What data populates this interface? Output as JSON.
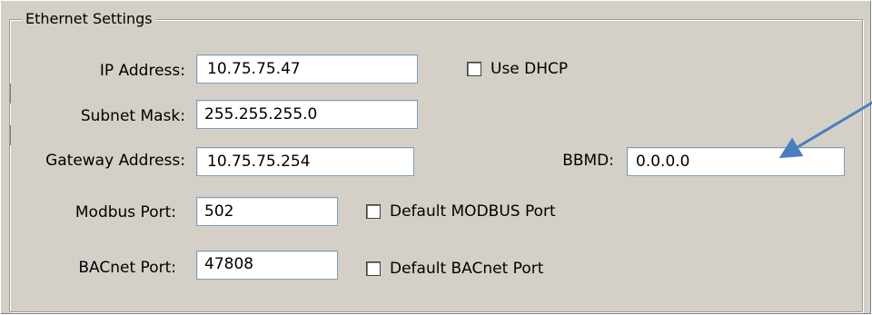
{
  "group": {
    "title": "Ethernet Settings"
  },
  "fields": {
    "ip_address": {
      "label": "IP Address:",
      "value": "10.75.75.47"
    },
    "subnet_mask": {
      "label": "Subnet Mask:",
      "value": "255.255.255.0"
    },
    "gateway_address": {
      "label": "Gateway Address:",
      "value": "10.75.75.254"
    },
    "bbmd": {
      "label": "BBMD:",
      "value": "0.0.0.0"
    },
    "modbus_port": {
      "label": "Modbus Port:",
      "value": "502"
    },
    "bacnet_port": {
      "label": "BACnet Port:",
      "value": "47808"
    }
  },
  "checkboxes": {
    "use_dhcp": {
      "label": "Use DHCP",
      "checked": false
    },
    "default_modbus_port": {
      "label": "Default MODBUS Port",
      "checked": false
    },
    "default_bacnet_port": {
      "label": "Default BACnet Port",
      "checked": false
    }
  },
  "annotation": {
    "arrow_color": "#4a7ebf"
  }
}
